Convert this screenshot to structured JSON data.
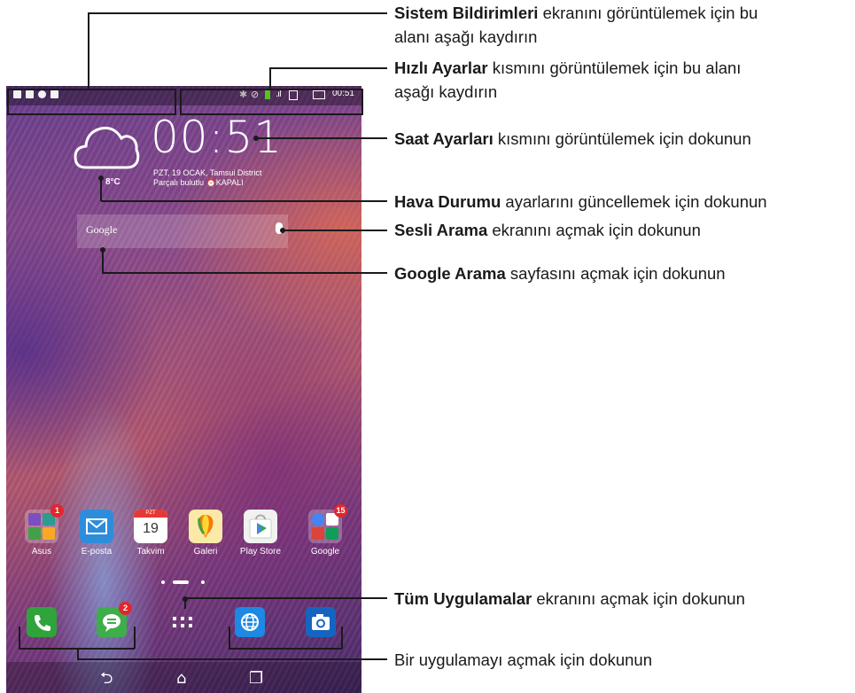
{
  "status_bar": {
    "time": "00:51"
  },
  "clock_widget": {
    "time": "00:51",
    "date_line": "PZT, 19 OCAK, Tamsui District",
    "weather_line": "Parçalı bulutlu  ⏰KAPALI",
    "temperature": "8°C"
  },
  "search_widget": {
    "label": "Google"
  },
  "apps": [
    {
      "label": "Asus",
      "icon": "folder-icon",
      "badge": "1"
    },
    {
      "label": "E-posta",
      "icon": "mail-icon",
      "badge": ""
    },
    {
      "label": "Takvim",
      "icon": "calendar-icon",
      "badge": "",
      "icon_header": "PZT",
      "icon_number": "19"
    },
    {
      "label": "Galeri",
      "icon": "gallery-icon",
      "badge": ""
    },
    {
      "label": "Play Store",
      "icon": "play-store-icon",
      "badge": ""
    },
    {
      "label": "Google",
      "icon": "google-folder-icon",
      "badge": "15"
    }
  ],
  "dock": [
    {
      "icon": "phone-icon",
      "badge": ""
    },
    {
      "icon": "messages-icon",
      "badge": "2"
    },
    {
      "icon": "all-apps-icon",
      "badge": ""
    },
    {
      "icon": "browser-icon",
      "badge": ""
    },
    {
      "icon": "camera-icon",
      "badge": ""
    }
  ],
  "nav": {
    "back": "⮌",
    "home": "⌂",
    "recents": "❐"
  },
  "callouts": [
    {
      "bold": "Sistem Bildirimleri",
      "text": " ekranını görüntülemek için bu",
      "text2": "alanı aşağı kaydırın"
    },
    {
      "bold": "Hızlı Ayarlar",
      "text": " kısmını görüntülemek için bu alanı",
      "text2": "aşağı kaydırın"
    },
    {
      "bold": "Saat Ayarları",
      "text": " kısmını görüntülemek için dokunun"
    },
    {
      "bold": "Hava Durumu",
      "text": " ayarlarını güncellemek için dokunun"
    },
    {
      "bold": "Sesli Arama",
      "text": " ekranını açmak için dokunun"
    },
    {
      "bold": "Google Arama",
      "text": " sayfasını açmak için dokunun"
    },
    {
      "bold": "Tüm Uygulamalar",
      "text": " ekranını açmak için dokunun"
    },
    {
      "bold": "",
      "text": "Bir uygulamayı açmak için dokunun"
    }
  ],
  "colors": {
    "badge": "#e2262b",
    "callout_line": "#1a1a1a"
  }
}
